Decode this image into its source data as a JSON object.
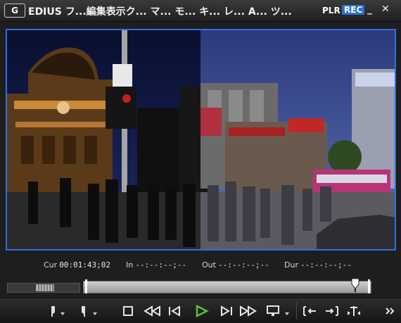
{
  "window": {
    "logo_text": "G",
    "title": "EDIUS フ...編集表示ク... マ... モ... キ... レ... A... ツ... 設定ヘ...",
    "plr_label": "PLR",
    "rec_label": "REC",
    "minimize_glyph": "_",
    "close_glyph": "✕"
  },
  "timecodes": {
    "cur": {
      "label": "Cur",
      "value": "00:01:43;02"
    },
    "in": {
      "label": "In",
      "value": "--:--:--;--"
    },
    "out": {
      "label": "Out",
      "value": "--:--:--;--"
    },
    "dur": {
      "label": "Dur",
      "value": "--:--:--;--"
    }
  },
  "playback": {
    "playhead_position": 0.945
  },
  "colors": {
    "accent_blue": "#2f6fe0",
    "play_green": "#5fbf3c",
    "rec_blue": "#2a6fd6"
  },
  "controls": {
    "icons": [
      "set-in-icon",
      "in-dropdown-icon",
      "set-out-icon",
      "out-dropdown-icon",
      "stop-icon",
      "rewind-icon",
      "step-back-icon",
      "play-icon",
      "step-forward-icon",
      "fast-forward-icon",
      "overlay-icon",
      "overlay-dropdown-icon",
      "insert-icon",
      "overwrite-icon",
      "split-icon",
      "more-icon"
    ]
  }
}
